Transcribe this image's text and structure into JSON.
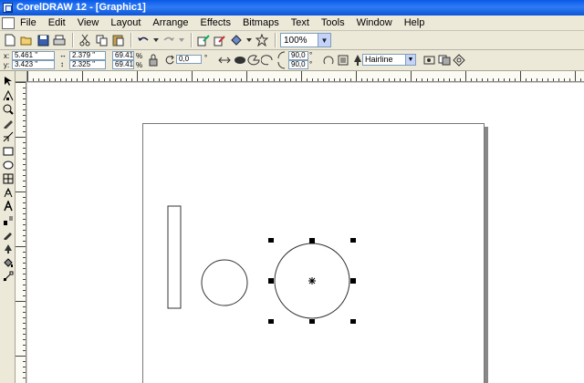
{
  "window": {
    "title": "CorelDRAW 12 - [Graphic1]"
  },
  "menu": {
    "items": [
      "File",
      "Edit",
      "View",
      "Layout",
      "Arrange",
      "Effects",
      "Bitmaps",
      "Text",
      "Tools",
      "Window",
      "Help"
    ]
  },
  "toolbar": {
    "zoom_value": "100%"
  },
  "property_bar": {
    "x_label": "x:",
    "x_value": "5.461 \"",
    "y_label": "y:",
    "y_value": "3.423 \"",
    "width_value": "2.379 \"",
    "height_value": "2.325 \"",
    "scale_w": "69.41",
    "scale_h": "69.41",
    "percent_1": "%",
    "percent_2": "%",
    "rotation_value": "0,0",
    "degree_1": "°",
    "arc_start": "90,0",
    "arc_end": "90,0",
    "degree_2": "°",
    "degree_3": "°",
    "outline_width": "Hairline"
  },
  "colors": {
    "title_bar": "#0a5ae8",
    "chrome": "#ece9d8",
    "canvas": "#ffffff",
    "selection_handle": "#000000"
  },
  "icons": [
    "new-icon",
    "open-icon",
    "save-icon",
    "print-icon",
    "cut-icon",
    "copy-icon",
    "paste-icon",
    "undo-icon",
    "redo-icon",
    "import-icon",
    "export-icon",
    "launcher-icon",
    "welcome-icon",
    "pick-tool-icon",
    "shape-tool-icon",
    "zoom-tool-icon",
    "freehand-tool-icon",
    "rectangle-tool-icon",
    "ellipse-tool-icon",
    "text-tool-icon",
    "fill-tool-icon"
  ]
}
